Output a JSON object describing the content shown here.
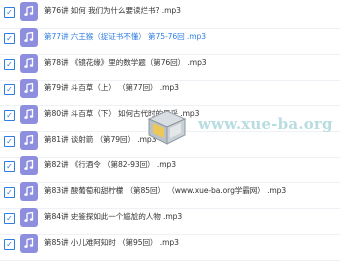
{
  "playlist": {
    "items": [
      {
        "title": "第76讲 如何 我们为什么要读烂书? .mp3",
        "checked": true,
        "active": false
      },
      {
        "title": "第77讲 六王猴（捉证书不懂） 第75-76回 .mp3",
        "checked": true,
        "active": true
      },
      {
        "title": "第78讲 《镜花缘》里的数学题（第76回） .mp3",
        "checked": true,
        "active": false
      },
      {
        "title": "第79讲 斗百草（上） （第77回） .mp3",
        "checked": true,
        "active": false
      },
      {
        "title": "第80讲 斗百草（下） 如何古代时的风采 .mp3",
        "checked": true,
        "active": false
      },
      {
        "title": "第81讲 谈射箭 （第79回） .mp3",
        "checked": true,
        "active": false
      },
      {
        "title": "第82讲 《行酒令 （第82-93回） .mp3",
        "checked": true,
        "active": false
      },
      {
        "title": "第83讲 酸葡萄和甜柠檬 （第85回） （www.xue-ba.org学霸网） .mp3",
        "checked": true,
        "active": false
      },
      {
        "title": "第84讲 史鉴探如此一个尴尬的人物 .mp3",
        "checked": true,
        "active": false
      },
      {
        "title": "第85讲 小儿难阿知时 （第95回） .mp3",
        "checked": true,
        "active": false
      }
    ],
    "icon_name": "music-note-icon"
  },
  "watermark": {
    "text": "www.xue-ba.org",
    "icon_name": "box-icon"
  },
  "colors": {
    "accent": "#2f7ee2",
    "icon_bg": "#8d8fde",
    "watermark": "#b7dde0"
  }
}
